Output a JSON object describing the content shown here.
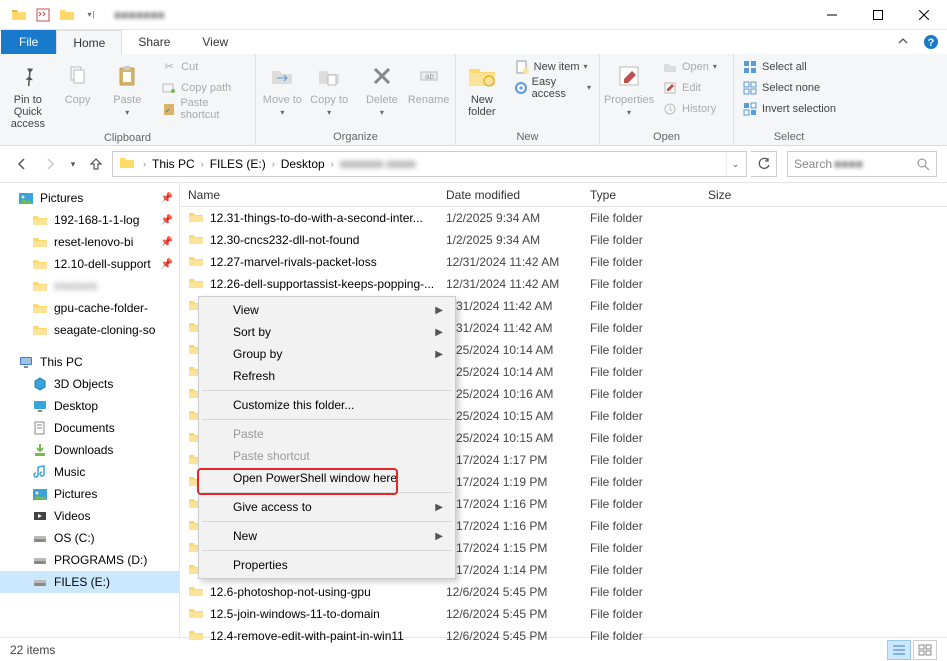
{
  "window": {
    "title_blur": "■■■■■■■"
  },
  "tabs": {
    "file": "File",
    "home": "Home",
    "share": "Share",
    "view": "View"
  },
  "ribbon": {
    "clipboard": {
      "label": "Clipboard",
      "pin": "Pin to Quick access",
      "copy": "Copy",
      "paste": "Paste",
      "cut": "Cut",
      "copypath": "Copy path",
      "pasteshort": "Paste shortcut"
    },
    "organize": {
      "label": "Organize",
      "moveto": "Move to",
      "copyto": "Copy to",
      "delete": "Delete",
      "rename": "Rename"
    },
    "new": {
      "label": "New",
      "newfolder": "New folder",
      "newitem": "New item",
      "easyaccess": "Easy access"
    },
    "open": {
      "label": "Open",
      "properties": "Properties",
      "open": "Open",
      "edit": "Edit",
      "history": "History"
    },
    "select": {
      "label": "Select",
      "selectall": "Select all",
      "selectnone": "Select none",
      "invert": "Invert selection"
    }
  },
  "breadcrumb": {
    "thispc": "This PC",
    "drive": "FILES (E:)",
    "desktop": "Desktop",
    "blur": "■■■■■■ ■■■■"
  },
  "search": {
    "placeholder": "Search",
    "blur": "■■■■"
  },
  "sidebar": {
    "items": [
      {
        "icon": "pictures",
        "label": "Pictures",
        "pinned": true,
        "indent": 0
      },
      {
        "icon": "folder",
        "label": "192-168-1-1-log",
        "pinned": true,
        "indent": 1
      },
      {
        "icon": "folder",
        "label": "reset-lenovo-bi",
        "pinned": true,
        "indent": 1
      },
      {
        "icon": "folder",
        "label": "12.10-dell-support",
        "pinned": true,
        "indent": 1
      },
      {
        "icon": "folder",
        "label": "■■■■■■",
        "pinned": false,
        "indent": 1,
        "blur": true
      },
      {
        "icon": "folder",
        "label": "gpu-cache-folder-",
        "pinned": false,
        "indent": 1
      },
      {
        "icon": "folder",
        "label": "seagate-cloning-so",
        "pinned": false,
        "indent": 1
      },
      {
        "icon": "thispc",
        "label": "This PC",
        "indent": 0,
        "spacer_before": true
      },
      {
        "icon": "3d",
        "label": "3D Objects",
        "indent": 1
      },
      {
        "icon": "desktop",
        "label": "Desktop",
        "indent": 1
      },
      {
        "icon": "documents",
        "label": "Documents",
        "indent": 1
      },
      {
        "icon": "downloads",
        "label": "Downloads",
        "indent": 1
      },
      {
        "icon": "music",
        "label": "Music",
        "indent": 1
      },
      {
        "icon": "pictures",
        "label": "Pictures",
        "indent": 1
      },
      {
        "icon": "videos",
        "label": "Videos",
        "indent": 1
      },
      {
        "icon": "drive",
        "label": "OS (C:)",
        "indent": 1
      },
      {
        "icon": "drive",
        "label": "PROGRAMS (D:)",
        "indent": 1
      },
      {
        "icon": "drive",
        "label": "FILES (E:)",
        "indent": 1,
        "selected": true
      }
    ]
  },
  "columns": {
    "name": "Name",
    "date": "Date modified",
    "type": "Type",
    "size": "Size"
  },
  "files": [
    {
      "name": "12.31-things-to-do-with-a-second-inter...",
      "date": "1/2/2025 9:34 AM",
      "type": "File folder"
    },
    {
      "name": "12.30-cncs232-dll-not-found",
      "date": "1/2/2025 9:34 AM",
      "type": "File folder"
    },
    {
      "name": "12.27-marvel-rivals-packet-loss",
      "date": "12/31/2024 11:42 AM",
      "type": "File folder"
    },
    {
      "name": "12.26-dell-supportassist-keeps-popping-...",
      "date": "12/31/2024 11:42 AM",
      "type": "File folder"
    },
    {
      "name": "",
      "date": "2/31/2024 11:42 AM",
      "type": "File folder"
    },
    {
      "name": "",
      "date": "2/31/2024 11:42 AM",
      "type": "File folder"
    },
    {
      "name": "",
      "date": "2/25/2024 10:14 AM",
      "type": "File folder"
    },
    {
      "name": "",
      "date": "2/25/2024 10:14 AM",
      "type": "File folder"
    },
    {
      "name": "",
      "date": "2/25/2024 10:16 AM",
      "type": "File folder"
    },
    {
      "name": "",
      "date": "2/25/2024 10:15 AM",
      "type": "File folder"
    },
    {
      "name": "",
      "date": "2/25/2024 10:15 AM",
      "type": "File folder"
    },
    {
      "name": "",
      "date": "2/17/2024 1:17 PM",
      "type": "File folder"
    },
    {
      "name": "",
      "date": "2/17/2024 1:19 PM",
      "type": "File folder"
    },
    {
      "name": "",
      "date": "2/17/2024 1:16 PM",
      "type": "File folder"
    },
    {
      "name": "",
      "date": "2/17/2024 1:16 PM",
      "type": "File folder"
    },
    {
      "name": "",
      "date": "2/17/2024 1:15 PM",
      "type": "File folder"
    },
    {
      "name": "",
      "date": "2/17/2024 1:14 PM",
      "type": "File folder"
    },
    {
      "name": "12.6-photoshop-not-using-gpu",
      "date": "12/6/2024 5:45 PM",
      "type": "File folder"
    },
    {
      "name": "12.5-join-windows-11-to-domain",
      "date": "12/6/2024 5:45 PM",
      "type": "File folder"
    },
    {
      "name": "12.4-remove-edit-with-paint-in-win11",
      "date": "12/6/2024 5:45 PM",
      "type": "File folder"
    }
  ],
  "contextmenu": {
    "view": "View",
    "sortby": "Sort by",
    "groupby": "Group by",
    "refresh": "Refresh",
    "customize": "Customize this folder...",
    "paste": "Paste",
    "pasteshort": "Paste shortcut",
    "powershell": "Open PowerShell window here",
    "giveaccess": "Give access to",
    "new": "New",
    "properties": "Properties"
  },
  "status": {
    "items": "22 items"
  }
}
